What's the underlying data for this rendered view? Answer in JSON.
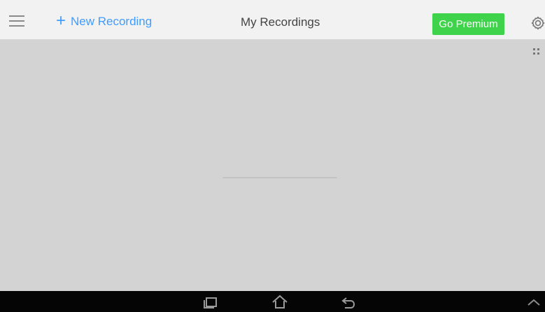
{
  "app": {
    "title": "My Recordings",
    "new_recording_label": "New Recording",
    "premium_label": "Go Premium"
  },
  "icons": {
    "menu": "hamburger-menu-icon",
    "new_recording": "plus-icon",
    "settings": "gear-icon",
    "view": "grid-view-icon",
    "recents": "recent-apps-icon",
    "home": "home-icon",
    "back": "back-icon",
    "collapse": "chevron-up-icon"
  },
  "colors": {
    "accent": "#3f9cff",
    "premium": "#3fd34b",
    "content_background": "#d3d3d3",
    "navigation_bar": "#050505"
  }
}
